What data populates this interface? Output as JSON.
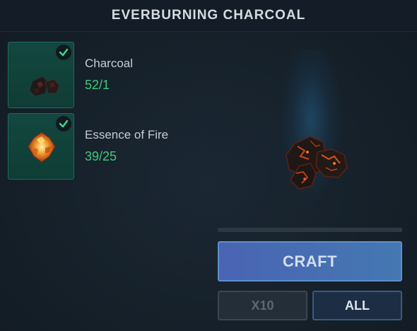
{
  "header": {
    "title": "EVERBURNING CHARCOAL"
  },
  "ingredients": [
    {
      "name": "Charcoal",
      "count": "52/1",
      "icon": "charcoal-icon",
      "met": true
    },
    {
      "name": "Essence of Fire",
      "count": "39/25",
      "icon": "essence-of-fire-icon",
      "met": true
    }
  ],
  "product": {
    "icon": "everburning-charcoal-icon"
  },
  "progress": {
    "fraction": 0
  },
  "buttons": {
    "craft": "CRAFT",
    "x10": "X10",
    "all": "ALL"
  },
  "colors": {
    "count_ok": "#41c97a",
    "craft_button": "#4a64b3",
    "slot_bg": "#13473f",
    "check": "#3ed98a"
  }
}
